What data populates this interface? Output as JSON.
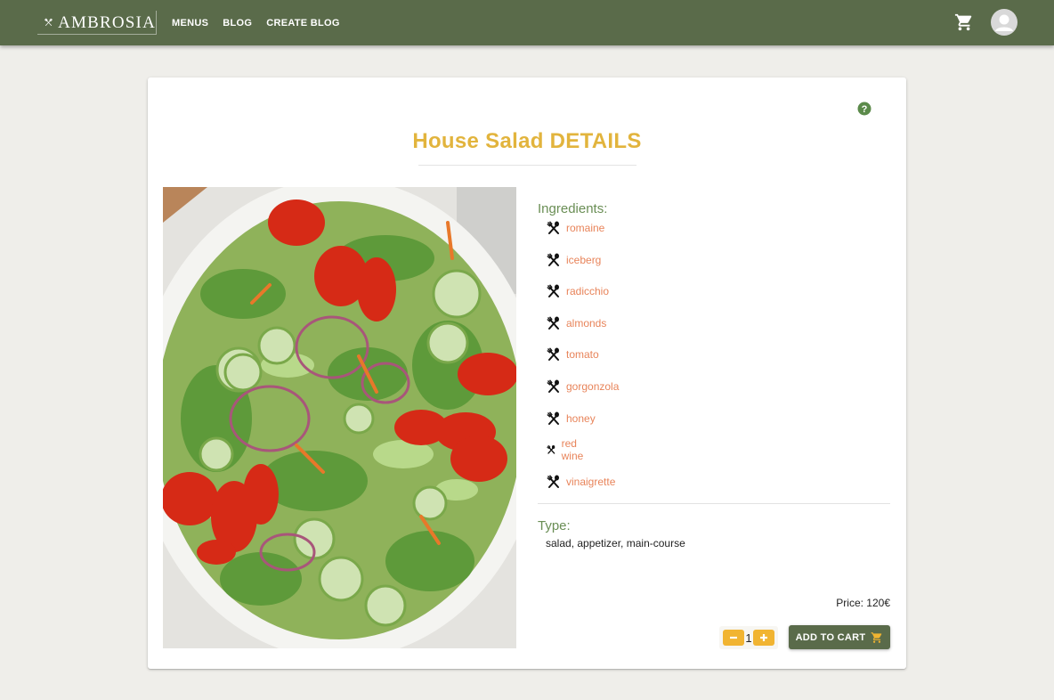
{
  "app": {
    "brand": "AMBROSIA",
    "nav": [
      {
        "label": "MENUS"
      },
      {
        "label": "BLOG"
      },
      {
        "label": "CREATE BLOG"
      }
    ],
    "colors": {
      "appbar": "#5a6b4a",
      "accent": "#e2b43d",
      "ingredient": "#e8845a",
      "label": "#6a8e55",
      "qty_button": "#f1b431"
    }
  },
  "detail": {
    "title": "House Salad DETAILS",
    "ingredients_label": "Ingredients:",
    "ingredients": [
      "romaine",
      "iceberg",
      "radicchio",
      "almonds",
      "tomato",
      "gorgonzola",
      "honey",
      "red wine",
      "vinaigrette"
    ],
    "ingredient_icon": "utensils-crossed-icon",
    "type_label": "Type:",
    "type_value": "salad, appetizer, main-course",
    "price": "Price: 120€",
    "quantity": "1",
    "add_to_cart_label": "ADD TO CART"
  }
}
